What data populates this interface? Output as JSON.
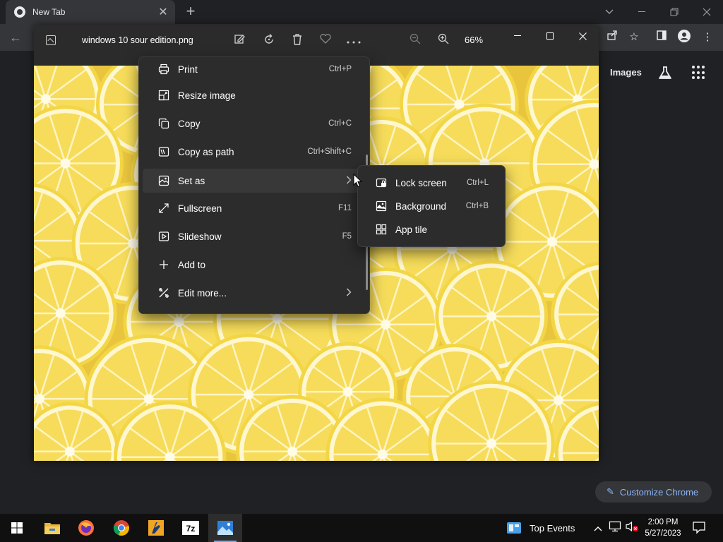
{
  "chrome": {
    "tab_title": "New Tab",
    "tab_close": "✕",
    "new_tab": "+",
    "ntp": {
      "images_link": "Images",
      "customize_button": "Customize Chrome"
    }
  },
  "photos": {
    "filename": "windows 10 sour edition.png",
    "zoom_level": "66%"
  },
  "context_menu": {
    "items": [
      {
        "label": "Print",
        "shortcut": "Ctrl+P",
        "icon": "printer-icon"
      },
      {
        "label": "Resize image",
        "shortcut": "",
        "icon": "resize-icon"
      },
      {
        "label": "Copy",
        "shortcut": "Ctrl+C",
        "icon": "copy-icon"
      },
      {
        "label": "Copy as path",
        "shortcut": "Ctrl+Shift+C",
        "icon": "path-icon"
      },
      {
        "label": "Set as",
        "shortcut": "",
        "icon": "set-as-icon"
      },
      {
        "label": "Fullscreen",
        "shortcut": "F11",
        "icon": "fullscreen-icon"
      },
      {
        "label": "Slideshow",
        "shortcut": "F5",
        "icon": "slideshow-icon"
      },
      {
        "label": "Add to",
        "shortcut": "",
        "icon": "plus-icon"
      },
      {
        "label": "Edit more...",
        "shortcut": "",
        "icon": "edit-more-icon"
      }
    ]
  },
  "submenu": {
    "items": [
      {
        "label": "Lock screen",
        "shortcut": "Ctrl+L",
        "icon": "lock-screen-icon"
      },
      {
        "label": "Background",
        "shortcut": "Ctrl+B",
        "icon": "background-icon"
      },
      {
        "label": "App tile",
        "shortcut": "",
        "icon": "app-tile-icon"
      }
    ]
  },
  "taskbar": {
    "top_events": "Top Events",
    "clock_time": "2:00 PM",
    "clock_date": "5/27/2023",
    "apps": [
      "file-explorer",
      "firefox",
      "chrome",
      "cs-app",
      "7zip",
      "photos"
    ],
    "seven_zip_label": "7z"
  },
  "colors": {
    "lemon": "#f2d64f",
    "menu_bg": "#2c2c2c",
    "link_blue": "#8ab4f8"
  }
}
